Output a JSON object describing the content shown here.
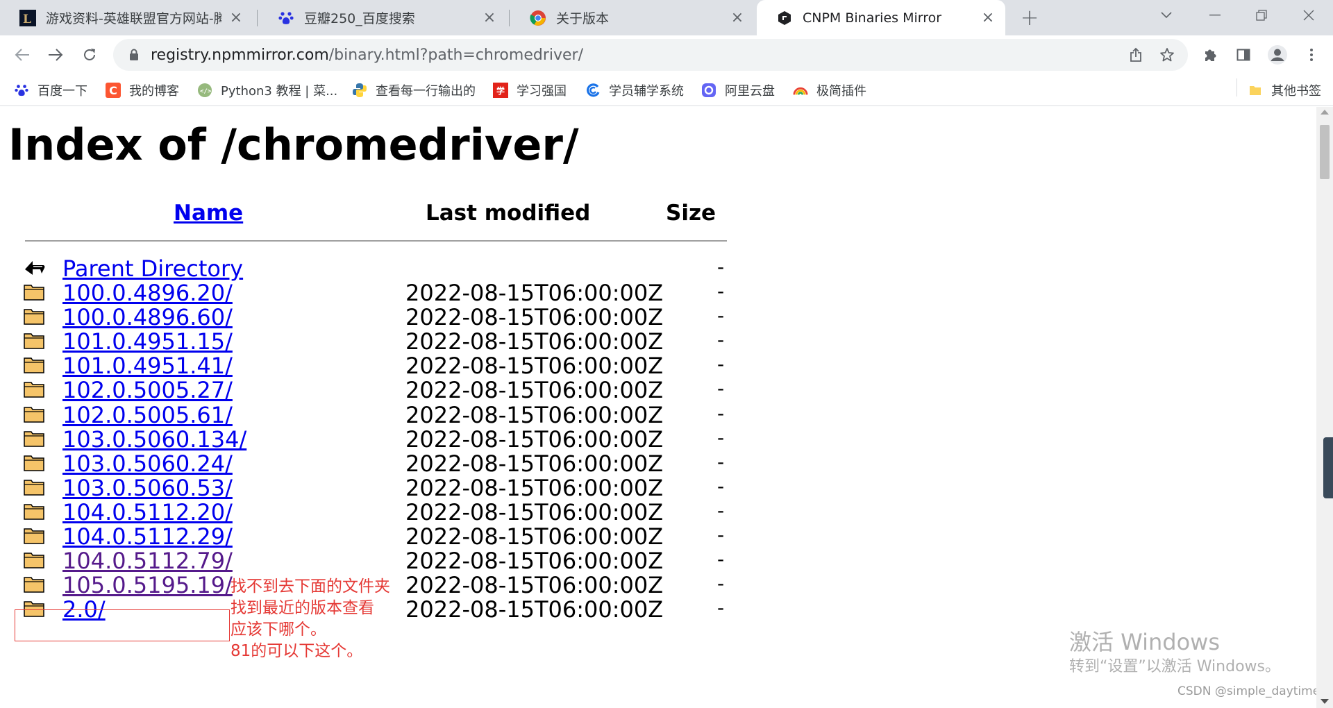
{
  "tabs": [
    {
      "title": "游戏资料-英雄联盟官方网站-腾讯",
      "favicon": "lol-icon",
      "active": false
    },
    {
      "title": "豆瓣250_百度搜索",
      "favicon": "baidu-paw-icon",
      "active": false
    },
    {
      "title": "关于版本",
      "favicon": "chrome-icon",
      "active": false
    },
    {
      "title": "CNPM Binaries Mirror",
      "favicon": "cnpm-icon",
      "active": true
    }
  ],
  "address": {
    "host": "registry.npmmirror.com",
    "path": "/binary.html?path=chromedriver/"
  },
  "bookmarks": [
    {
      "label": "百度一下",
      "icon": "baidu-paw-icon",
      "color": "#2932e1"
    },
    {
      "label": "我的博客",
      "icon": "csdn-icon",
      "color": "#fc5531"
    },
    {
      "label": "Python3 教程 | 菜...",
      "icon": "runoob-icon",
      "color": "#96b97d"
    },
    {
      "label": "查看每一行输出的",
      "icon": "python-icon",
      "color": "#3776ab"
    },
    {
      "label": "学习强国",
      "icon": "xuexi-icon",
      "color": "#e2231a"
    },
    {
      "label": "学员辅学系统",
      "icon": "swirl-icon",
      "color": "#1a73e8"
    },
    {
      "label": "阿里云盘",
      "icon": "aliyun-icon",
      "color": "#6365f4"
    },
    {
      "label": "极简插件",
      "icon": "rainbow-icon",
      "color": "#e94235"
    }
  ],
  "other_bookmarks": "其他书签",
  "page": {
    "title": "Index of /chromedriver/",
    "columns": {
      "name": "Name",
      "modified": "Last modified",
      "size": "Size"
    },
    "parent": {
      "name": "Parent Directory",
      "size": "-"
    },
    "rows": [
      {
        "name": "100.0.4896.20/",
        "modified": "2022-08-15T06:00:00Z",
        "size": "-"
      },
      {
        "name": "100.0.4896.60/",
        "modified": "2022-08-15T06:00:00Z",
        "size": "-"
      },
      {
        "name": "101.0.4951.15/",
        "modified": "2022-08-15T06:00:00Z",
        "size": "-"
      },
      {
        "name": "101.0.4951.41/",
        "modified": "2022-08-15T06:00:00Z",
        "size": "-"
      },
      {
        "name": "102.0.5005.27/",
        "modified": "2022-08-15T06:00:00Z",
        "size": "-"
      },
      {
        "name": "102.0.5005.61/",
        "modified": "2022-08-15T06:00:00Z",
        "size": "-"
      },
      {
        "name": "103.0.5060.134/",
        "modified": "2022-08-15T06:00:00Z",
        "size": "-"
      },
      {
        "name": "103.0.5060.24/",
        "modified": "2022-08-15T06:00:00Z",
        "size": "-"
      },
      {
        "name": "103.0.5060.53/",
        "modified": "2022-08-15T06:00:00Z",
        "size": "-"
      },
      {
        "name": "104.0.5112.20/",
        "modified": "2022-08-15T06:00:00Z",
        "size": "-"
      },
      {
        "name": "104.0.5112.29/",
        "modified": "2022-08-15T06:00:00Z",
        "size": "-"
      },
      {
        "name": "104.0.5112.79/",
        "modified": "2022-08-15T06:00:00Z",
        "size": "-",
        "visited": true
      },
      {
        "name": "105.0.5195.19/",
        "modified": "2022-08-15T06:00:00Z",
        "size": "-",
        "visited": true
      },
      {
        "name": "2.0/",
        "modified": "2022-08-15T06:00:00Z",
        "size": "-"
      }
    ]
  },
  "annotation": {
    "lines": [
      "找不到去下面的文件夹",
      "找到最近的版本查看",
      "应该下哪个。",
      "81的可以下这个。"
    ],
    "color": "#e53935"
  },
  "watermark": {
    "line1": "激活 Windows",
    "line2": "转到“设置”以激活 Windows。",
    "credit": "CSDN @simple_daytime"
  }
}
